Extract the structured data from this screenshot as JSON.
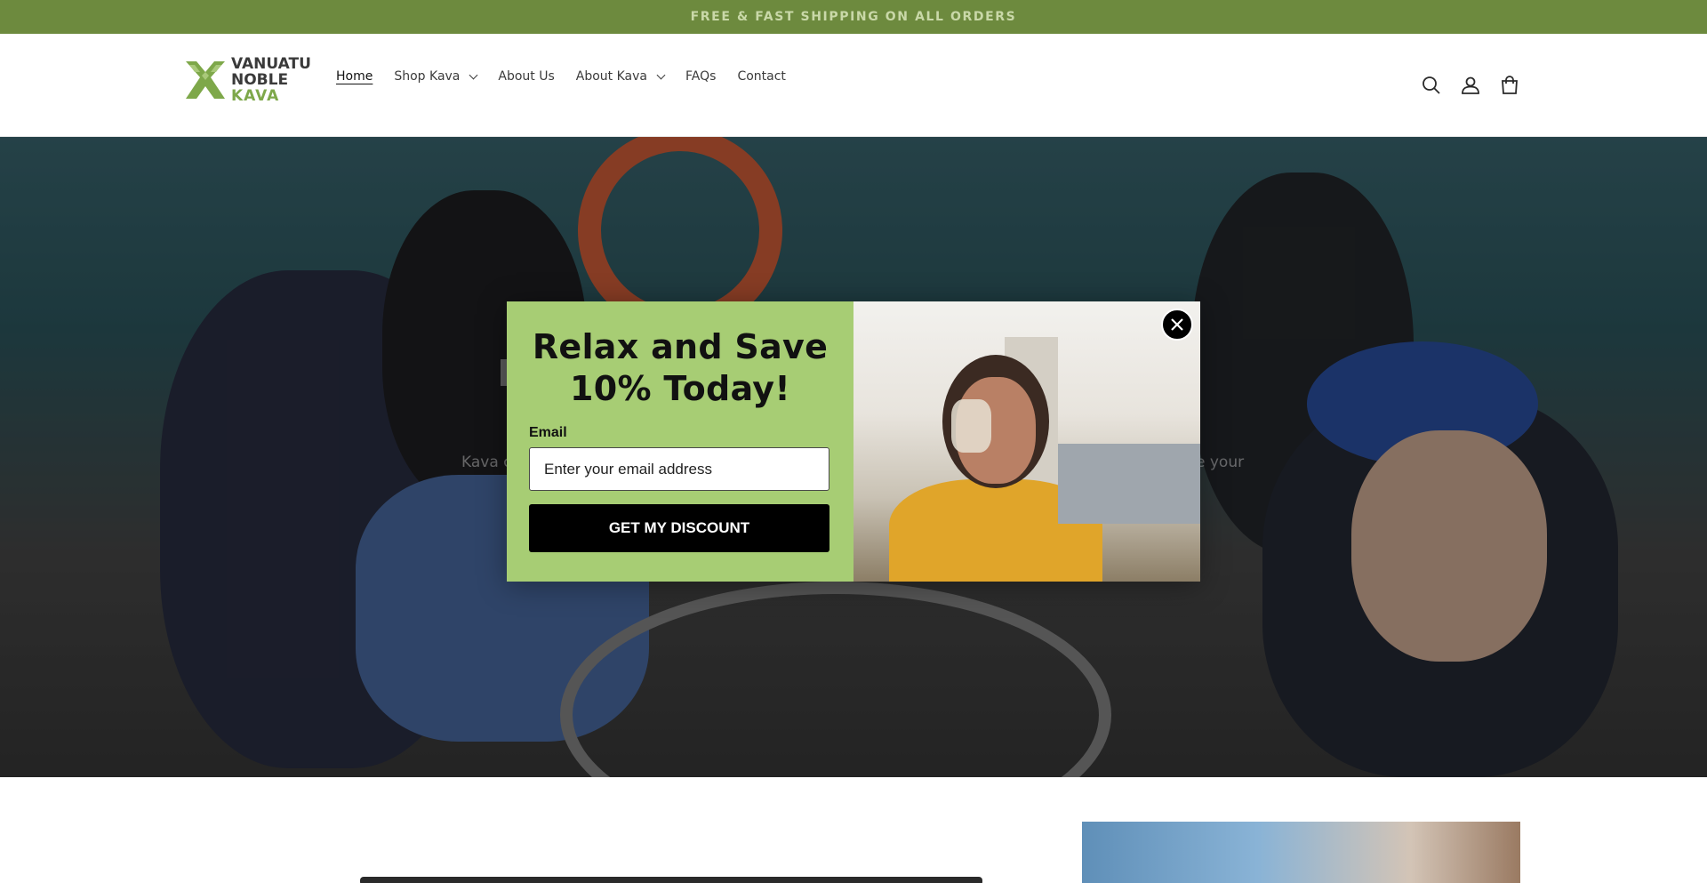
{
  "announcement": {
    "text": "FREE & FAST SHIPPING ON ALL ORDERS"
  },
  "logo": {
    "line1": "VANUATU",
    "line2": "NOBLE",
    "line3": "KAVA",
    "icon": "kava-leaf-logo"
  },
  "nav": {
    "items": [
      {
        "label": "Home",
        "active": true,
        "dropdown": false
      },
      {
        "label": "Shop Kava",
        "active": false,
        "dropdown": true
      },
      {
        "label": "About Us",
        "active": false,
        "dropdown": false
      },
      {
        "label": "About Kava",
        "active": false,
        "dropdown": true
      },
      {
        "label": "FAQs",
        "active": false,
        "dropdown": false
      },
      {
        "label": "Contact",
        "active": false,
        "dropdown": false
      }
    ]
  },
  "header_icons": [
    "search-icon",
    "account-icon",
    "cart-icon"
  ],
  "hero": {
    "text_left": "Kava c",
    "text_right": "e your"
  },
  "popup": {
    "title": "Relax and Save 10% Today!",
    "email_label": "Email",
    "email_placeholder": "Enter your email address",
    "email_value": "",
    "button_label": "GET MY DISCOUNT",
    "close_icon": "close-icon"
  },
  "colors": {
    "announcement_bg": "#6d8a3e",
    "popup_bg": "#a7cd74",
    "button_bg": "#000000",
    "logo_green": "#7ea84a"
  }
}
